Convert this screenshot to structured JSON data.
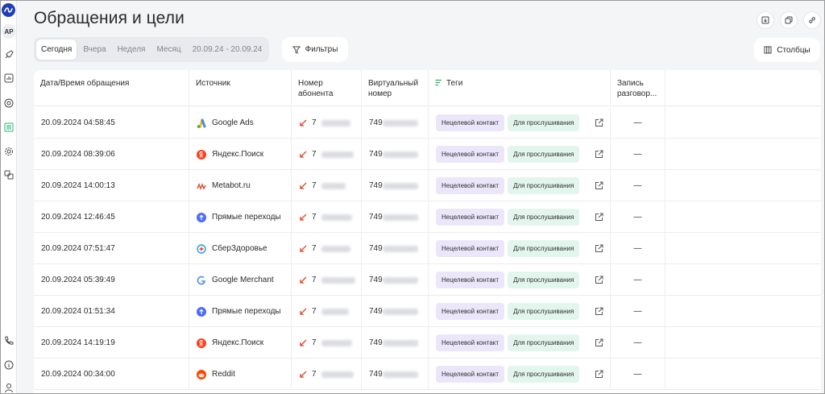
{
  "sidebar": {
    "avatar": "АР",
    "icons": [
      "rocket-icon",
      "bar-chart-icon",
      "at-sign-icon",
      "list-icon",
      "gear-icon",
      "integrations-icon"
    ],
    "bottom_icons": [
      "phone-icon",
      "info-icon",
      "user-icon"
    ]
  },
  "header": {
    "title": "Обращения и цели",
    "actions": [
      "download-icon",
      "copy-icon",
      "link-icon"
    ]
  },
  "toolbar": {
    "date_tabs": [
      {
        "label": "Сегодня",
        "active": true
      },
      {
        "label": "Вчера",
        "active": false
      },
      {
        "label": "Неделя",
        "active": false
      },
      {
        "label": "Месяц",
        "active": false
      },
      {
        "label": "20.09.24 - 20.09.24",
        "active": false
      }
    ],
    "filters_label": "Фильтры",
    "columns_label": "Столбцы"
  },
  "table": {
    "headers": {
      "date": "Дата/Время обращения",
      "source": "Источник",
      "number_line1": "Номер",
      "number_line2": "абонента",
      "virtual_line1": "Виртуальный",
      "virtual_line2": "номер",
      "tags": "Теги",
      "record_line1": "Запись",
      "record_line2": "разговор..."
    },
    "rows": [
      {
        "date": "20.09.2024 04:58:45",
        "source": "Google Ads",
        "source_icon": "google-ads-icon",
        "number_prefix": "7",
        "virtual_prefix": "749",
        "tag1": "Нецелевой контакт",
        "tag2": "Для прослушивания",
        "record": "—"
      },
      {
        "date": "20.09.2024 08:39:06",
        "source": "Яндекс.Поиск",
        "source_icon": "yandex-icon",
        "number_prefix": "7",
        "virtual_prefix": "749",
        "tag1": "Нецелевой контакт",
        "tag2": "Для прослушивания",
        "record": "—"
      },
      {
        "date": "20.09.2024 14:00:13",
        "source": "Metabot.ru",
        "source_icon": "metabot-icon",
        "number_prefix": "7",
        "virtual_prefix": "749",
        "tag1": "Нецелевой контакт",
        "tag2": "Для прослушивания",
        "record": "—"
      },
      {
        "date": "20.09.2024 12:46:45",
        "source": "Прямые переходы",
        "source_icon": "direct-visit-icon",
        "number_prefix": "7",
        "virtual_prefix": "749",
        "tag1": "Нецелевой контакт",
        "tag2": "Для прослушивания",
        "record": "—"
      },
      {
        "date": "20.09.2024 07:51:47",
        "source": "СберЗдоровье",
        "source_icon": "sberhealth-icon",
        "number_prefix": "7",
        "virtual_prefix": "749",
        "tag1": "Нецелевой контакт",
        "tag2": "Для прослушивания",
        "record": "—"
      },
      {
        "date": "20.09.2024 05:39:49",
        "source": "Google Merchant",
        "source_icon": "google-icon",
        "number_prefix": "7",
        "virtual_prefix": "749",
        "tag1": "Нецелевой контакт",
        "tag2": "Для прослушивания",
        "record": "—"
      },
      {
        "date": "20.09.2024 01:51:34",
        "source": "Прямые переходы",
        "source_icon": "direct-visit-icon",
        "number_prefix": "7",
        "virtual_prefix": "749",
        "tag1": "Нецелевой контакт",
        "tag2": "Для прослушивания",
        "record": "—"
      },
      {
        "date": "20.09.2024 14:19:19",
        "source": "Яндекс.Поиск",
        "source_icon": "yandex-icon",
        "number_prefix": "7",
        "virtual_prefix": "749",
        "tag1": "Нецелевой контакт",
        "tag2": "Для прослушивания",
        "record": "—"
      },
      {
        "date": "20.09.2024 00:34:00",
        "source": "Reddit",
        "source_icon": "reddit-icon",
        "number_prefix": "7",
        "virtual_prefix": "749",
        "tag1": "Нецелевой контакт",
        "tag2": "Для прослушивания",
        "record": "—"
      }
    ]
  },
  "colors": {
    "accent_blue": "#1f3fb8",
    "tag_purple": "#ece6fb",
    "tag_green": "#e3f6ee",
    "incoming_call": "#e0452b"
  }
}
